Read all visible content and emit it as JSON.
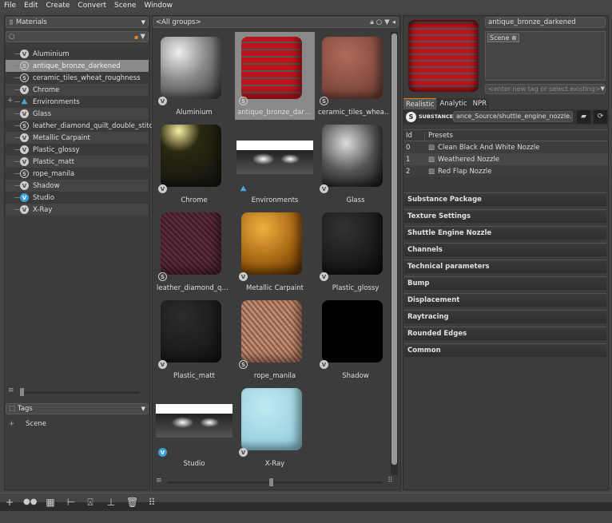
{
  "menu": [
    "File",
    "Edit",
    "Create",
    "Convert",
    "Scene",
    "Window"
  ],
  "left": {
    "library_select": "Materials",
    "search_placeholder": "",
    "tree": [
      {
        "label": "Aluminium",
        "icon": "vray"
      },
      {
        "label": "antique_bronze_darkened",
        "icon": "substance",
        "selected": true
      },
      {
        "label": "ceramic_tiles_wheat_roughness",
        "icon": "substance"
      },
      {
        "label": "Chrome",
        "icon": "vray"
      },
      {
        "label": "Environments",
        "icon": "environment",
        "expandable": true
      },
      {
        "label": "Glass",
        "icon": "vray"
      },
      {
        "label": "leather_diamond_quilt_double_stitch",
        "icon": "substance"
      },
      {
        "label": "Metallic Carpaint",
        "icon": "vray"
      },
      {
        "label": "Plastic_glossy",
        "icon": "vray"
      },
      {
        "label": "Plastic_matt",
        "icon": "vray"
      },
      {
        "label": "rope_manila",
        "icon": "substance"
      },
      {
        "label": "Shadow",
        "icon": "vray"
      },
      {
        "label": "Studio",
        "icon": "studio"
      },
      {
        "label": "X-Ray",
        "icon": "vray"
      }
    ],
    "tags_select": "Tags",
    "tags_tree": [
      "Scene"
    ]
  },
  "middle": {
    "group_select": "<All groups>",
    "grid": [
      {
        "label": "Aluminium",
        "icon": "vray",
        "look": "aluminium"
      },
      {
        "label": "antique_bronze_darkened",
        "icon": "substance",
        "look": "red",
        "selected": true
      },
      {
        "label": "ceramic_tiles_wheat_roughness",
        "icon": "substance",
        "look": "ceramic"
      },
      {
        "label": "Chrome",
        "icon": "vray",
        "look": "chrome"
      },
      {
        "label": "Environments",
        "icon": "environment",
        "look": "env"
      },
      {
        "label": "Glass",
        "icon": "vray",
        "look": "glass"
      },
      {
        "label": "leather_diamond_quilt_double_stitch",
        "icon": "substance",
        "look": "leather"
      },
      {
        "label": "Metallic Carpaint",
        "icon": "vray",
        "look": "gold"
      },
      {
        "label": "Plastic_glossy",
        "icon": "vray",
        "look": "black"
      },
      {
        "label": "Plastic_matt",
        "icon": "vray",
        "look": "matt"
      },
      {
        "label": "rope_manila",
        "icon": "substance",
        "look": "rope"
      },
      {
        "label": "Shadow",
        "icon": "vray",
        "look": "shadow"
      },
      {
        "label": "Studio",
        "icon": "studio",
        "look": "env"
      },
      {
        "label": "X-Ray",
        "icon": "vray",
        "look": "xray"
      }
    ]
  },
  "right": {
    "material_name": "antique_bronze_darkened",
    "tags": [
      "Scene"
    ],
    "tag_placeholder": "<enter new tag or select existing>",
    "tabs": [
      "Realistic",
      "Analytic",
      "NPR"
    ],
    "active_tab": "Realistic",
    "substance_logo": "SUBSTANCE",
    "sbsar_path": "ance_Source/shuttle_engine_nozzle.sbsar",
    "presets_header": {
      "id": "Id",
      "name": "Presets"
    },
    "presets": [
      {
        "id": "0",
        "name": "Clean Black And White Nozzle"
      },
      {
        "id": "1",
        "name": "Weathered Nozzle"
      },
      {
        "id": "2",
        "name": "Red Flap Nozzle"
      }
    ],
    "sections": [
      "Substance Package",
      "Texture Settings",
      "Shuttle Engine Nozzle",
      "Channels",
      "Technical parameters",
      "Bump",
      "Displacement",
      "Raytracing",
      "Rounded Edges",
      "Common"
    ]
  },
  "colors": {
    "accent": "#e08a1e",
    "selection": "#8a8a8a",
    "panel": "#3c3c3c"
  }
}
